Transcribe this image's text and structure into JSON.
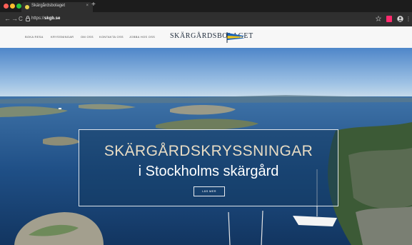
{
  "browser": {
    "tab_title": "Skärgårdsbolaget",
    "tab_close": "×",
    "new_tab": "+",
    "url_prefix": "https://",
    "url_domain": "skgb.se",
    "nav_back": "←",
    "nav_forward": "→",
    "nav_reload": "C",
    "colors": {
      "close": "#ff5f57",
      "minimize": "#febc2e",
      "maximize": "#28c840"
    }
  },
  "site": {
    "nav": {
      "boka_resa": "BOKA RESA",
      "kryssningar": "KRYSSNINGAR",
      "om_oss": "OM OSS",
      "kontakta_oss": "KONTAKTA OSS",
      "jobba_hos_oss": "JOBBA HOS OSS"
    },
    "brand_name": "SKÄRGÅRDSBOLAGET",
    "logo": "flag-logo"
  },
  "hero": {
    "title": "SKÄRGÅRDSKRYSSNINGAR",
    "subtitle": "i Stockholms skärgård",
    "button_label": "LÄS MER",
    "image": "aerial view of archipelago islands with sailing boats"
  }
}
